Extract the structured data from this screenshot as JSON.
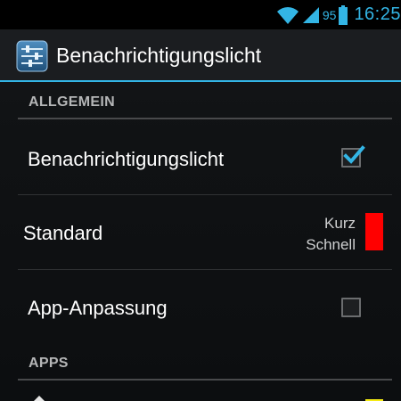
{
  "status_bar": {
    "battery_level": "95",
    "time": "16:25",
    "icons": [
      "wifi-icon",
      "signal-icon",
      "battery-icon"
    ],
    "accent_color": "#33b5e5"
  },
  "action_bar": {
    "title": "Benachrichtigungslicht",
    "icon": "settings-sliders-icon",
    "underline_color": "#33b5e5"
  },
  "sections": {
    "general": {
      "header": "ALLGEMEIN",
      "items": {
        "notification_light": {
          "title": "Benachrichtigungslicht",
          "checked": true
        },
        "standard": {
          "title": "Standard",
          "duration": "Kurz",
          "speed": "Schnell",
          "color": "#ff0000"
        },
        "app_adjust": {
          "title": "App-Anpassung",
          "checked": false
        }
      }
    },
    "apps": {
      "header": "APPS",
      "first_item_color": "#f5ea14"
    }
  }
}
